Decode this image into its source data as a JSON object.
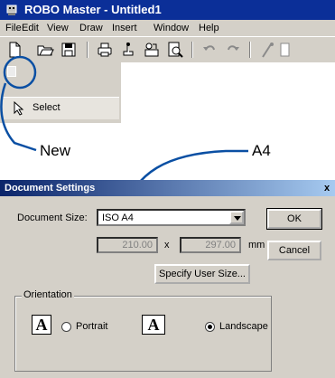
{
  "app": {
    "title": "ROBO Master - Untitled1",
    "menus": [
      "File",
      "Edit",
      "View",
      "Draw",
      "Insert",
      "Window",
      "Help"
    ],
    "toolbar_icons": [
      "new-document-icon",
      "open-folder-icon",
      "save-icon",
      "print-icon",
      "print-preview-icon",
      "page-setup-icon",
      "zoom-icon",
      "undo-icon",
      "redo-icon",
      "cut-icon"
    ],
    "side_panel": {
      "select_label": "Select"
    }
  },
  "callouts": {
    "new_label": "New",
    "a4_label": "A4"
  },
  "dialog": {
    "title": "Document Settings",
    "close_glyph": "x",
    "document_size_label": "Document Size:",
    "document_size_value": "ISO A4",
    "width_value": "210.00",
    "times_sign": "x",
    "height_value": "297.00",
    "unit": "mm",
    "specify_user_size_label": "Specify User Size...",
    "ok_label": "OK",
    "cancel_label": "Cancel",
    "orientation_group_label": "Orientation",
    "portrait_label": "Portrait",
    "landscape_label": "Landscape",
    "orientation_icon_glyph": "A",
    "selected_orientation": "Landscape"
  },
  "colors": {
    "title_bar": "#0b2f98",
    "dialog_title_start": "#0a246a",
    "dialog_title_end": "#a6caf0",
    "callout_line": "#0a4fa3",
    "face": "#d4d0c8"
  }
}
